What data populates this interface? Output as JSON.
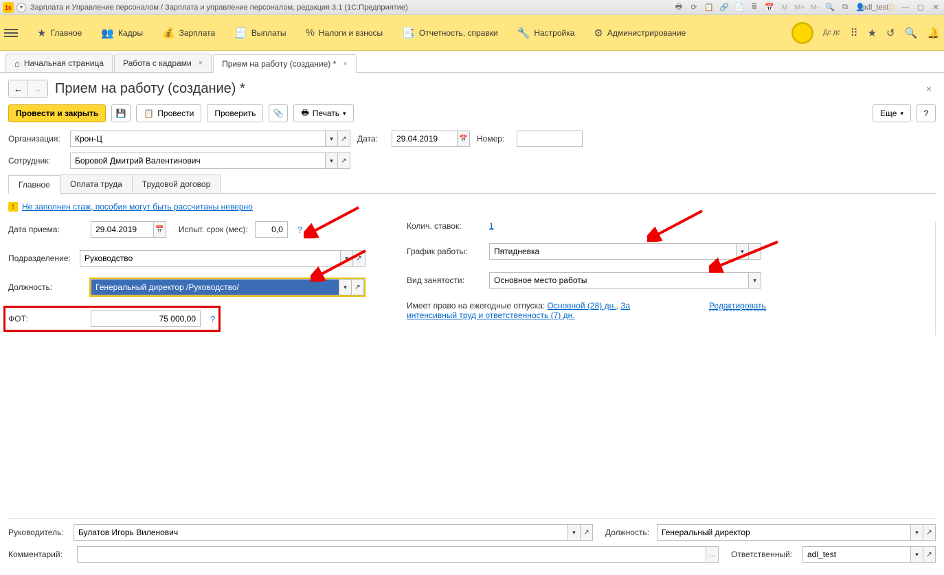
{
  "titlebar": {
    "app_title": "Зарплата и Управление персоналом / Зарплата и управление персоналом, редакция 3.1  (1С:Предприятие)",
    "user": "adl_test"
  },
  "mainmenu": {
    "items": [
      {
        "label": "Главное"
      },
      {
        "label": "Кадры"
      },
      {
        "label": "Зарплата"
      },
      {
        "label": "Выплаты"
      },
      {
        "label": "Налоги и взносы"
      },
      {
        "label": "Отчетность, справки"
      },
      {
        "label": "Настройка"
      },
      {
        "label": "Администрирование"
      }
    ],
    "extra": "Дс\nдс"
  },
  "tabs": {
    "items": [
      {
        "label": "Начальная страница",
        "home": true,
        "close": false
      },
      {
        "label": "Работа с кадрами",
        "close": true
      },
      {
        "label": "Прием на работу (создание) *",
        "close": true,
        "active": true
      }
    ]
  },
  "page": {
    "title": "Прием на работу (создание) *",
    "toolbar": {
      "process_close": "Провести и закрыть",
      "process": "Провести",
      "check": "Проверить",
      "print": "Печать",
      "more": "Еще"
    },
    "header_fields": {
      "organization_label": "Организация:",
      "organization": "Крон-Ц",
      "date_label": "Дата:",
      "date": "29.04.2019",
      "number_label": "Номер:",
      "number": "",
      "employee_label": "Сотрудник:",
      "employee": "Боровой Дмитрий Валентинович"
    },
    "inner_tabs": {
      "main": "Главное",
      "pay": "Оплата труда",
      "contract": "Трудовой договор"
    },
    "warning": "Не заполнен стаж, пособия могут быть рассчитаны неверно",
    "left": {
      "accept_date_label": "Дата приема:",
      "accept_date": "29.04.2019",
      "probation_label": "Испыт. срок (мес):",
      "probation": "0,0",
      "department_label": "Подразделение:",
      "department": "Руководство",
      "position_label": "Должность:",
      "position": "Генеральный директор /Руководство/",
      "fot_label": "ФОТ:",
      "fot": "75 000,00"
    },
    "right": {
      "rates_label": "Колич. ставок:",
      "rates": "1",
      "schedule_label": "График работы:",
      "schedule": "Пятидневка",
      "employment_label": "Вид занятости:",
      "employment": "Основное место работы",
      "vacation_prefix": "Имеет право на ежегодные отпуска: ",
      "vacation_link1": "Основной (28) дн.",
      "vacation_mid": ", ",
      "vacation_link2": "За интенсивный труд и ответственность (7) дн.",
      "edit": "Редактировать"
    },
    "footer": {
      "manager_label": "Руководитель:",
      "manager": "Булатов Игорь Виленович",
      "position_label": "Должность:",
      "position": "Генеральный директор",
      "comment_label": "Комментарий:",
      "comment": "",
      "responsible_label": "Ответственный:",
      "responsible": "adl_test"
    }
  }
}
